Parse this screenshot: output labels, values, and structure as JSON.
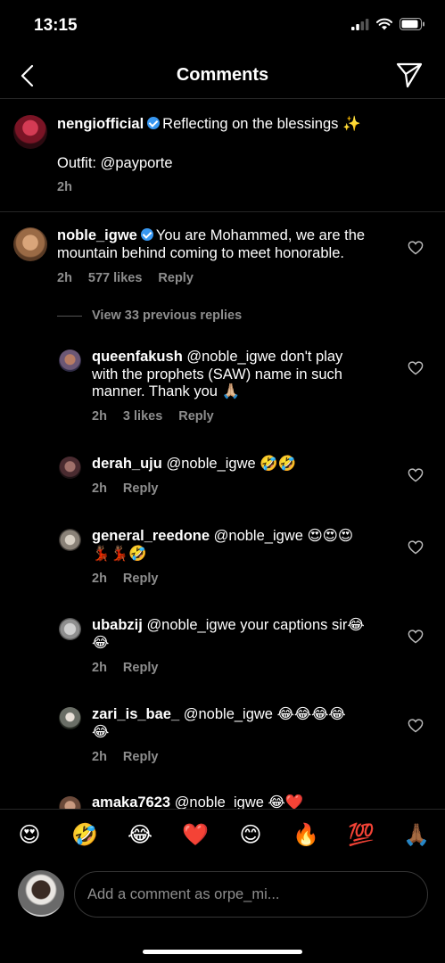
{
  "status": {
    "time": "13:15"
  },
  "header": {
    "title": "Comments"
  },
  "caption": {
    "username": "nengiofficial",
    "text": "Reflecting on the blessings ✨",
    "outfit": "Outfit: @payporte",
    "time": "2h"
  },
  "main_comment": {
    "username": "noble_igwe",
    "text": "You are Mohammed, we are the",
    "text2": "mountain behind coming to meet honorable.",
    "time": "2h",
    "likes": "577 likes",
    "reply": "Reply"
  },
  "view_replies": "View 33 previous replies",
  "replies": [
    {
      "username": "queenfakush",
      "line1": "@noble_igwe don't play",
      "line2": "with the prophets (SAW) name in such",
      "line3": "manner. Thank you 🙏🏼",
      "time": "2h",
      "likes": "3 likes",
      "reply": "Reply"
    },
    {
      "username": "derah_uju",
      "line1": "@noble_igwe 🤣🤣",
      "time": "2h",
      "reply": "Reply"
    },
    {
      "username": "general_reedone",
      "line1": "@noble_igwe 😍😍😍",
      "line2": "💃🏾💃🏾🤣",
      "time": "2h",
      "reply": "Reply"
    },
    {
      "username": "ubabzij",
      "line1": "@noble_igwe your captions sir😂",
      "line2": "😂",
      "time": "2h",
      "reply": "Reply"
    },
    {
      "username": "zari_is_bae_",
      "line1": "@noble_igwe 😂😂😂😂",
      "line2": "😂",
      "time": "2h",
      "reply": "Reply"
    },
    {
      "username": "amaka7623",
      "line1": "@noble_igwe 😂❤️"
    }
  ],
  "emoji_bar": [
    "😍",
    "🤣",
    "😂",
    "❤️",
    "😊",
    "🔥",
    "💯",
    "🙏🏾"
  ],
  "input": {
    "placeholder": "Add a comment as orpe_mi..."
  },
  "colors": {
    "background": "#000000",
    "secondary_text": "#8e8e8e",
    "verified": "#3897f0",
    "divider": "#262626"
  }
}
